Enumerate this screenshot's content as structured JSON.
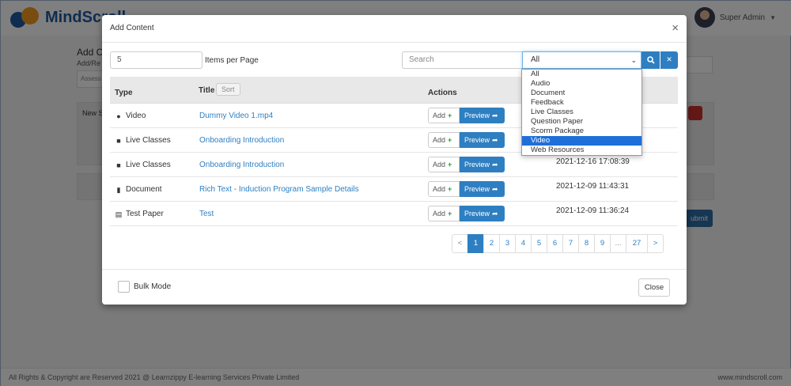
{
  "app": {
    "brand": "MindScroll",
    "user_name": "Super Admin"
  },
  "background": {
    "page_title": "Add Co",
    "page_sub": "Add/Re",
    "input_hint": "Assess",
    "section_label": "New S",
    "submit_label": "ubmit",
    "footer_left": "All Rights & Copyright are Reserved 2021 @ Learnzippy E-learning Services Private Limited",
    "footer_right": "www.mindscroll.com"
  },
  "modal": {
    "title": "Add Content",
    "close_icon": "×",
    "items_per_page_value": "5",
    "items_per_page_label": "Items per Page",
    "search_placeholder": "Search",
    "filter_selected": "All",
    "filter_options": [
      "All",
      "Audio",
      "Document",
      "Feedback",
      "Live Classes",
      "Question Paper",
      "Scorm Package",
      "Video",
      "Web Resources"
    ],
    "filter_highlighted": "Video",
    "columns": {
      "type": "Type",
      "title": "Title",
      "sort": "Sort",
      "actions": "Actions"
    },
    "add_label": "Add",
    "preview_label": "Preview",
    "rows": [
      {
        "type": "Video",
        "icon": "play-circle-icon",
        "title": "Dummy Video 1.mp4",
        "date": ""
      },
      {
        "type": "Live Classes",
        "icon": "video-camera-icon",
        "title": "Onboarding Introduction",
        "date": ""
      },
      {
        "type": "Live Classes",
        "icon": "video-camera-icon",
        "title": "Onboarding Introduction",
        "date": "2021-12-16 17:08:39"
      },
      {
        "type": "Document",
        "icon": "book-icon",
        "title": "Rich Text - Induction Program Sample Details",
        "date": "2021-12-09 11:43:31"
      },
      {
        "type": "Test Paper",
        "icon": "list-alt-icon",
        "title": "Test",
        "date": "2021-12-09 11:36:24"
      }
    ],
    "pagination": {
      "prev": "<",
      "pages": [
        "1",
        "2",
        "3",
        "4",
        "5",
        "6",
        "7",
        "8",
        "9"
      ],
      "ellipsis": "...",
      "last": "27",
      "next": ">",
      "current": "1"
    },
    "bulk_mode_label": "Bulk Mode",
    "close_label": "Close"
  },
  "colors": {
    "primary": "#2e7fc1",
    "dropdown_highlight": "#1e6fd9",
    "brand_blue": "#1e5aa0",
    "brand_orange": "#f39a1f",
    "delete_red": "#c9302c"
  }
}
